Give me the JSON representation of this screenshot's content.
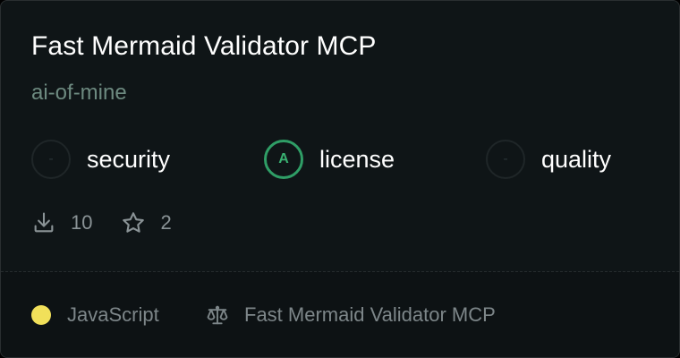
{
  "server": {
    "title": "Fast Mermaid Validator MCP",
    "owner": "ai-of-mine"
  },
  "scores": [
    {
      "grade": "-",
      "label": "security",
      "graded": false
    },
    {
      "grade": "A",
      "label": "license",
      "graded": true
    },
    {
      "grade": "-",
      "label": "quality",
      "graded": false
    }
  ],
  "stats": {
    "downloads": "10",
    "stars": "2",
    "downloads_icon": "download-icon",
    "stars_icon": "star-icon"
  },
  "footer": {
    "language": "JavaScript",
    "language_color": "#f1e05a",
    "license_name": "Fast Mermaid Validator MCP",
    "license_icon": "scale-icon"
  },
  "colors": {
    "card_bg": "#0f1517",
    "accent_green": "#2f9e66",
    "owner_text": "#6d8a80"
  }
}
